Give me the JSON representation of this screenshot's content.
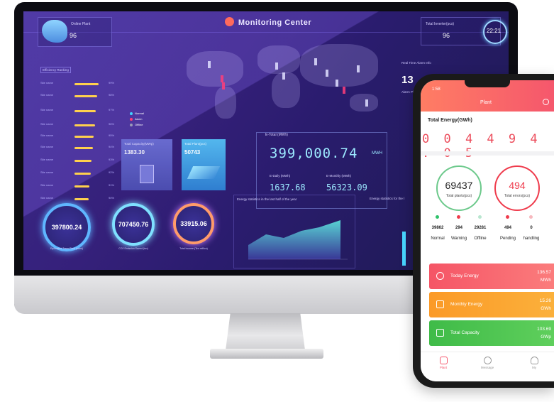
{
  "dashboard": {
    "title": "Monitoring Center",
    "online_plant_label": "Online Plant",
    "online_plant_value": "96",
    "total_inverter_label": "Total Inverter(pcs)",
    "total_inverter_value": "96",
    "clock": "22:21",
    "efficiency_ranking_title": "Efficiency Ranking",
    "real_time_alarm_title": "Real Time Alarm Info",
    "alarm_count": "13",
    "alarm_pl_label": "Alarm Pl",
    "legend": [
      {
        "label": "Normal",
        "color": "#3fd3ff"
      },
      {
        "label": "Alarm",
        "color": "#ff3d7a"
      },
      {
        "label": "Offline",
        "color": "#9a9ab8"
      }
    ],
    "total_capacity_label": "Total Capacity(MWp)",
    "total_capacity_value": "1383.30",
    "total_plants_label": "Total Plant(pcs)",
    "total_plants_value": "50743",
    "etotal_label": "E-Total (MWh)",
    "etotal_value": "399,000.74",
    "etotal_unit": "MWH",
    "edaily_label": "E-Daily (MWh)",
    "edaily_value": "1637.68",
    "emonthly_label": "E-Monthly (MWh)",
    "emonthly_value": "56323.09",
    "gauges": [
      {
        "value": "397800.24",
        "label": "Equivalent Trees Plant (trees)",
        "color": "#5fb6ff"
      },
      {
        "value": "707450.76",
        "label": "CO2 Emission Saved (ton)",
        "color": "#7fe0ff"
      },
      {
        "value": "33915.06",
        "label": "Total Income (Ten million)",
        "color": "#ff9b6a"
      }
    ],
    "chart_title": "Energy statistics in the last half of the year",
    "chart2_title": "Energy statistics for the l"
  },
  "phone": {
    "time": "1:58",
    "header_title": "Plant",
    "total_energy_label": "Total Energy(GWh)",
    "total_energy_value": "0 0 4 4 9 4 . 0 5",
    "total_plants_value": "69437",
    "total_plants_label": "Total plants(pcs)",
    "total_errors_value": "494",
    "total_errors_label": "Total errors(pcs)",
    "stats": [
      {
        "value": "39862",
        "label": "Normal",
        "color": "#2ec26a"
      },
      {
        "value": "294",
        "label": "Warning",
        "color": "#ef3b4c"
      },
      {
        "value": "29281",
        "label": "Offline",
        "color": "#b8e6cf"
      },
      {
        "value": "494",
        "label": "Pending",
        "color": "#ef3b4c"
      },
      {
        "value": "0",
        "label": "handling",
        "color": "#f7b8be"
      }
    ],
    "cards": [
      {
        "label": "Today Energy",
        "value": "136.57",
        "unit": "MWh",
        "color": "#f55566"
      },
      {
        "label": "Monthly Energy",
        "value": "15.26",
        "unit": "GWh",
        "color": "#fb9a27"
      },
      {
        "label": "Total Capacity",
        "value": "103.69",
        "unit": "GWp",
        "color": "#47c24f"
      }
    ],
    "tabs": [
      {
        "label": "Plant",
        "color": "#f5576c"
      },
      {
        "label": "Message",
        "color": "#9a9a9a"
      },
      {
        "label": "My",
        "color": "#9a9a9a"
      }
    ]
  }
}
